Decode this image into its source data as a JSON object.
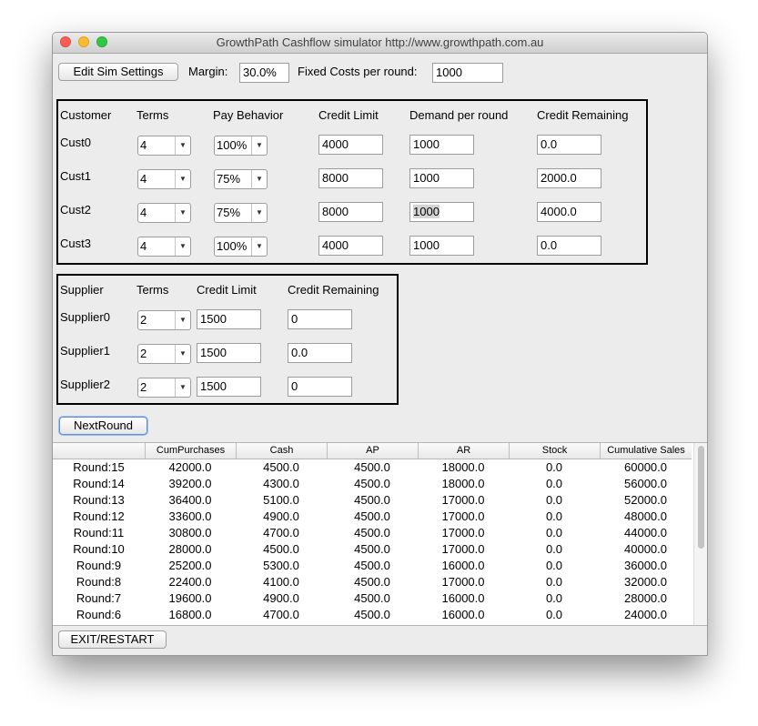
{
  "window": {
    "title": "GrowthPath Cashflow simulator http://www.growthpath.com.au"
  },
  "top": {
    "edit_button": "Edit Sim Settings",
    "margin_label": "Margin:",
    "margin_value": "30.0%",
    "fixed_costs_label": "Fixed Costs per round:",
    "fixed_costs_value": "1000"
  },
  "customers": {
    "headers": [
      "Customer",
      "Terms",
      "Pay Behavior",
      "Credit Limit",
      "Demand per round",
      "Credit Remaining"
    ],
    "rows": [
      {
        "name": "Cust0",
        "terms": "4",
        "pay": "100%",
        "credit_limit": "4000",
        "demand": "1000",
        "credit_remaining": "0.0"
      },
      {
        "name": "Cust1",
        "terms": "4",
        "pay": "75%",
        "credit_limit": "8000",
        "demand": "1000",
        "credit_remaining": "2000.0"
      },
      {
        "name": "Cust2",
        "terms": "4",
        "pay": "75%",
        "credit_limit": "8000",
        "demand": "1000",
        "credit_remaining": "4000.0"
      },
      {
        "name": "Cust3",
        "terms": "4",
        "pay": "100%",
        "credit_limit": "4000",
        "demand": "1000",
        "credit_remaining": "0.0"
      }
    ]
  },
  "suppliers": {
    "headers": [
      "Supplier",
      "Terms",
      "Credit Limit",
      "Credit Remaining"
    ],
    "rows": [
      {
        "name": "Supplier0",
        "terms": "2",
        "credit_limit": "1500",
        "credit_remaining": "0"
      },
      {
        "name": "Supplier1",
        "terms": "2",
        "credit_limit": "1500",
        "credit_remaining": "0.0"
      },
      {
        "name": "Supplier2",
        "terms": "2",
        "credit_limit": "1500",
        "credit_remaining": "0"
      }
    ]
  },
  "next_round_button": "NextRound",
  "results": {
    "headers": [
      "",
      "CumPurchases",
      "Cash",
      "AP",
      "AR",
      "Stock",
      "Cumulative Sales"
    ],
    "rows": [
      [
        "Round:15",
        "42000.0",
        "4500.0",
        "4500.0",
        "18000.0",
        "0.0",
        "60000.0"
      ],
      [
        "Round:14",
        "39200.0",
        "4300.0",
        "4500.0",
        "18000.0",
        "0.0",
        "56000.0"
      ],
      [
        "Round:13",
        "36400.0",
        "5100.0",
        "4500.0",
        "17000.0",
        "0.0",
        "52000.0"
      ],
      [
        "Round:12",
        "33600.0",
        "4900.0",
        "4500.0",
        "17000.0",
        "0.0",
        "48000.0"
      ],
      [
        "Round:11",
        "30800.0",
        "4700.0",
        "4500.0",
        "17000.0",
        "0.0",
        "44000.0"
      ],
      [
        "Round:10",
        "28000.0",
        "4500.0",
        "4500.0",
        "17000.0",
        "0.0",
        "40000.0"
      ],
      [
        "Round:9",
        "25200.0",
        "5300.0",
        "4500.0",
        "16000.0",
        "0.0",
        "36000.0"
      ],
      [
        "Round:8",
        "22400.0",
        "4100.0",
        "4500.0",
        "17000.0",
        "0.0",
        "32000.0"
      ],
      [
        "Round:7",
        "19600.0",
        "4900.0",
        "4500.0",
        "16000.0",
        "0.0",
        "28000.0"
      ],
      [
        "Round:6",
        "16800.0",
        "4700.0",
        "4500.0",
        "16000.0",
        "0.0",
        "24000.0"
      ]
    ]
  },
  "exit_button": "EXIT/RESTART",
  "icons": {
    "dropdown": "chevron-down-icon"
  }
}
